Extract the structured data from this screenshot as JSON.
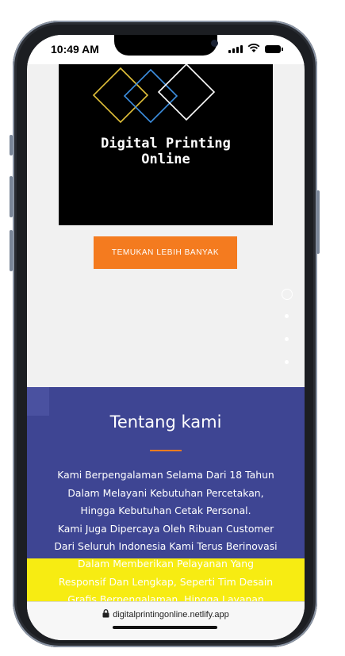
{
  "status_bar": {
    "time": "10:49 AM",
    "icons": [
      "cellular-signal-icon",
      "wifi-icon",
      "battery-icon"
    ]
  },
  "hero": {
    "image_title": "Digital Printing\nOnline",
    "logo_icon": "overlapping-diamonds-logo",
    "logo_colors": [
      "#e2c13a",
      "#3d8fe0",
      "#ffffff"
    ],
    "cta_label": "TEMUKAN LEBIH BANYAK",
    "cta_color": "#f47b1f"
  },
  "slider": {
    "dot_count": 4,
    "active_index": 0
  },
  "about": {
    "title": "Tentang kami",
    "body_lines": [
      "Kami Berpengalaman Selama Dari 18 Tahun",
      "Dalam Melayani Kebutuhan Percetakan,",
      "Hingga Kebutuhan Cetak Personal.",
      "Kami Juga Dipercaya Oleh Ribuan Customer",
      "Dari Seluruh Indonesia Kami Terus Berinovasi"
    ],
    "overflow_lines": [
      "Dalam Memberikan Pelayanan Yang",
      "Responsif Dan Lengkap, Seperti Tim Desain",
      "Grafis Berpengalaman, Hingga Layanan"
    ],
    "background_color": "#3e4593",
    "accent_color": "#f47b1f",
    "band_color": "#f7ec12"
  },
  "browser": {
    "url": "digitalprintingonline.netlify.app",
    "lock_icon": "lock-icon"
  }
}
